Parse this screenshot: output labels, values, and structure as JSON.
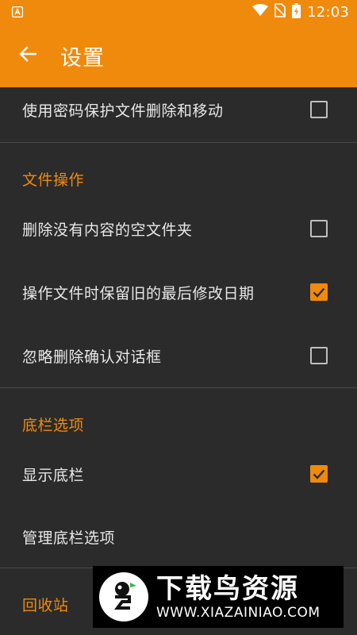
{
  "status_bar": {
    "time": "12:03",
    "icons": [
      "app-notification-icon",
      "wifi-icon",
      "no-sim-icon",
      "battery-charging-icon"
    ]
  },
  "app_bar": {
    "title": "设置",
    "back_icon": "arrow-left-icon"
  },
  "settings": {
    "protect_move_delete": {
      "label": "使用密码保护文件删除和移动",
      "checked": false
    },
    "section_file_ops": {
      "title": "文件操作"
    },
    "delete_empty_folders": {
      "label": "删除没有内容的空文件夹",
      "checked": false
    },
    "keep_last_modified": {
      "label": "操作文件时保留旧的最后修改日期",
      "checked": true
    },
    "skip_delete_confirm": {
      "label": "忽略删除确认对话框",
      "checked": false
    },
    "section_bottom_bar": {
      "title": "底栏选项"
    },
    "show_bottom_bar": {
      "label": "显示底栏",
      "checked": true
    },
    "manage_bottom_bar": {
      "label": "管理底栏选项"
    },
    "section_recycle_bin": {
      "title": "回收站"
    }
  },
  "watermark": {
    "name": "下载鸟资源",
    "url": "WWW.XIAZAINIAO.COM"
  },
  "colors": {
    "accent": "#f08a0c",
    "background": "#2b2b2b",
    "divider": "#4a4a4a"
  }
}
